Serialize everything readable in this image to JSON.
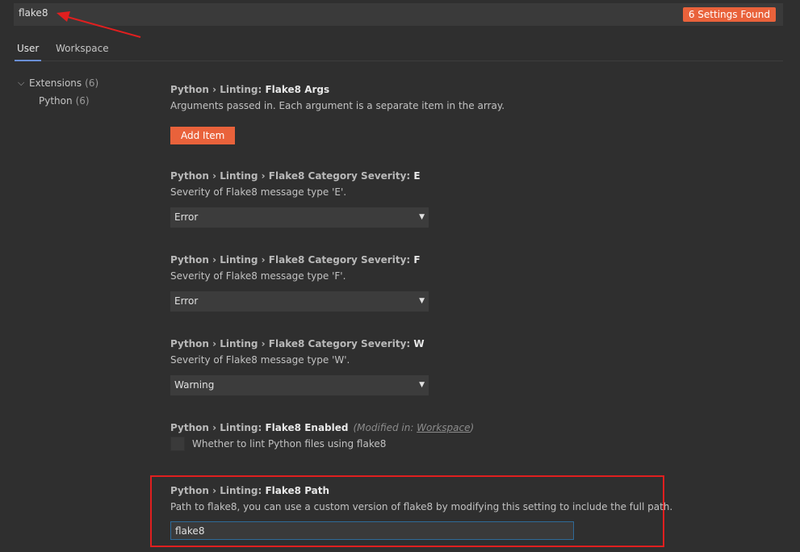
{
  "search": {
    "value": "flake8",
    "results_badge": "6 Settings Found"
  },
  "tabs": [
    {
      "label": "User",
      "active": true
    },
    {
      "label": "Workspace",
      "active": false
    }
  ],
  "tree": {
    "extensions_label": "Extensions",
    "extensions_count": "(6)",
    "python_label": "Python",
    "python_count": "(6)"
  },
  "settings": {
    "args": {
      "category": "Python › Linting: ",
      "key": "Flake8 Args",
      "description": "Arguments passed in. Each argument is a separate item in the array.",
      "button_label": "Add Item"
    },
    "severity_e": {
      "category": "Python › Linting › Flake8 Category Severity: ",
      "key": "E",
      "description": "Severity of Flake8 message type 'E'.",
      "value": "Error"
    },
    "severity_f": {
      "category": "Python › Linting › Flake8 Category Severity: ",
      "key": "F",
      "description": "Severity of Flake8 message type 'F'.",
      "value": "Error"
    },
    "severity_w": {
      "category": "Python › Linting › Flake8 Category Severity: ",
      "key": "W",
      "description": "Severity of Flake8 message type 'W'.",
      "value": "Warning"
    },
    "enabled": {
      "category": "Python › Linting: ",
      "key": "Flake8 Enabled",
      "modified_prefix": "(Modified in: ",
      "modified_link": "Workspace",
      "modified_suffix": ")",
      "description": "Whether to lint Python files using flake8",
      "checked": false
    },
    "path": {
      "category": "Python › Linting: ",
      "key": "Flake8 Path",
      "description": "Path to flake8, you can use a custom version of flake8 by modifying this setting to include the full path.",
      "value": "flake8"
    }
  },
  "colors": {
    "accent": "#e9623b",
    "annotation": "#e01f1f",
    "background": "#2f2f2f",
    "active_tab": "#6a8fd6"
  },
  "icons": {
    "caret": "caret-down-icon",
    "chevron": "chevron-down-icon"
  }
}
